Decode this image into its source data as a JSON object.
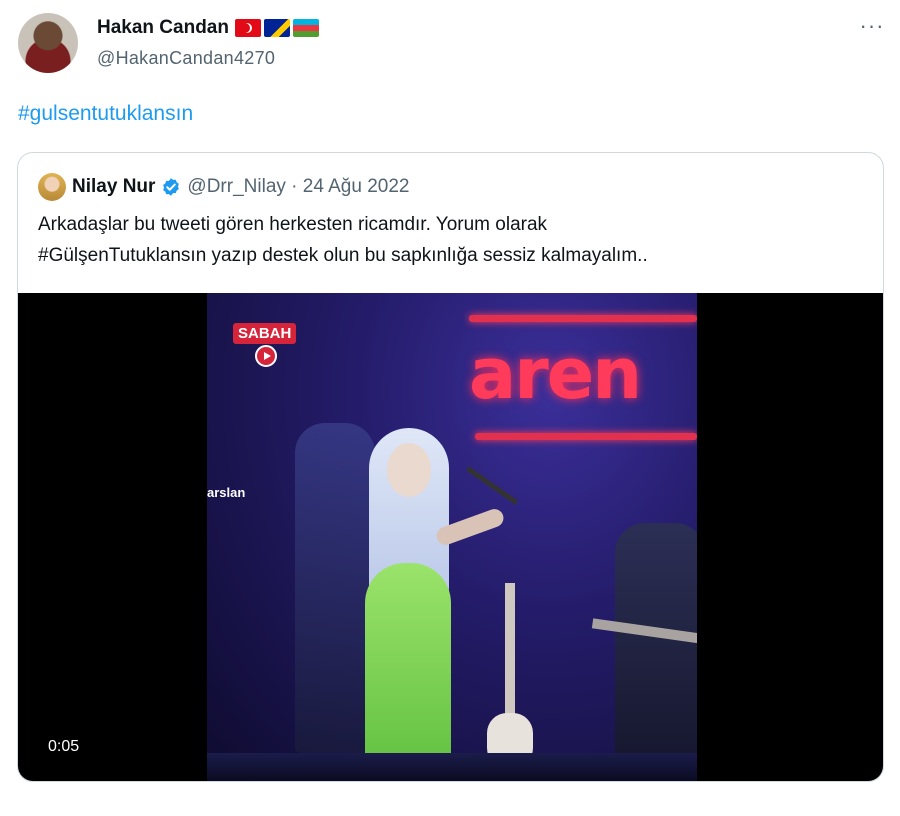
{
  "tweet": {
    "author_name": "Hakan Candan",
    "author_handle": "@HakanCandan4270",
    "flags": [
      "turkey-flag",
      "bosnia-flag",
      "azerbaijan-flag"
    ],
    "hashtag": "#gulsentutuklansın",
    "more_icon": "more-dots-icon"
  },
  "quoted_tweet": {
    "author_name": "Nilay Nur",
    "verified": true,
    "handle_date": "@Drr_Nilay · 24 Ağu 2022",
    "text_lines": [
      "Arkadaşlar bu tweeti gören herkesten ricamdır. Yorum olarak",
      "#GülşenTutuklansın yazıp destek olun bu sapkınlığa sessiz kalmayalım.."
    ]
  },
  "video": {
    "timestamp": "0:05",
    "channel_logo": "SABAH",
    "sign_text": "aren",
    "side_caption": "arslan"
  },
  "colors": {
    "link": "#1d9bf0",
    "secondary_text": "#536471",
    "border": "#cfd9de"
  }
}
